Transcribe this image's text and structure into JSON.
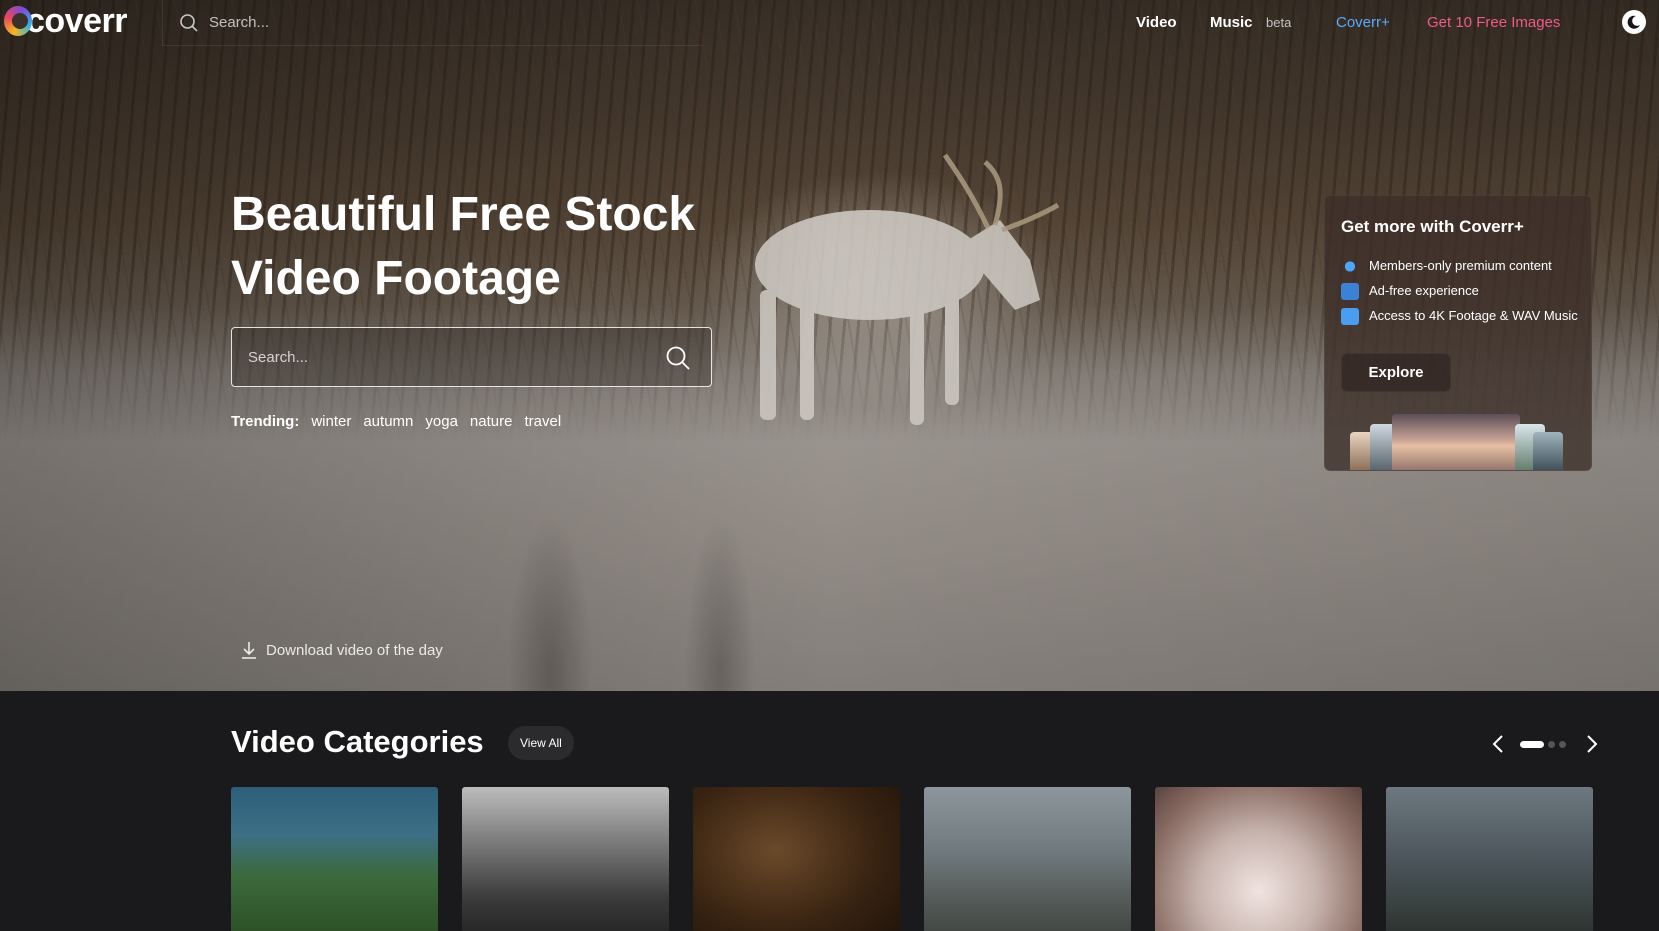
{
  "nav": {
    "logo_text": "coverr",
    "search_placeholder": "Search...",
    "links": {
      "video": "Video",
      "music": "Music",
      "music_badge": "beta",
      "coverr_plus": "Coverr+",
      "free_images": "Get 10 Free Images"
    },
    "accent_plus": "#5aa9ff",
    "accent_free": "#ef5a8a"
  },
  "hero": {
    "headline": "Beautiful Free Stock Video Footage",
    "search_placeholder": "Search...",
    "trending_label": "Trending:",
    "trending": [
      "winter",
      "autumn",
      "yoga",
      "nature",
      "travel"
    ],
    "download_video_of_day": "Download video of the day"
  },
  "promo": {
    "title": "Get more with Coverr+",
    "benefits": [
      {
        "icon": "star-badge-icon",
        "text": "Members-only premium content"
      },
      {
        "icon": "no-ads-icon",
        "text": "Ad-free experience"
      },
      {
        "icon": "4k-icon",
        "text": "Access to 4K Footage & WAV Music"
      }
    ],
    "explore_label": "Explore"
  },
  "categories": {
    "title": "Video Categories",
    "view_all": "View All",
    "page_count": 3,
    "active_page": 1
  }
}
